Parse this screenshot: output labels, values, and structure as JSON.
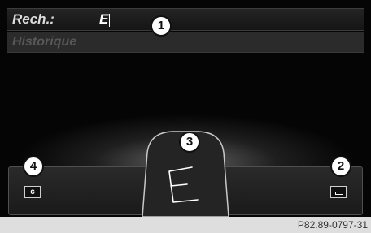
{
  "search": {
    "label": "Rech.:",
    "value": "E"
  },
  "history": {
    "label": "Historique"
  },
  "handwriting": {
    "glyph": "E"
  },
  "controls": {
    "clear_label": "c",
    "space_icon": "space-bar-icon"
  },
  "callouts": [
    "1",
    "2",
    "3",
    "4"
  ],
  "footer": {
    "reference": "P82.89-0797-31"
  },
  "colors": {
    "background": "#050505",
    "text": "#ffffff",
    "history_text": "#575757",
    "footer": "#dedede"
  }
}
